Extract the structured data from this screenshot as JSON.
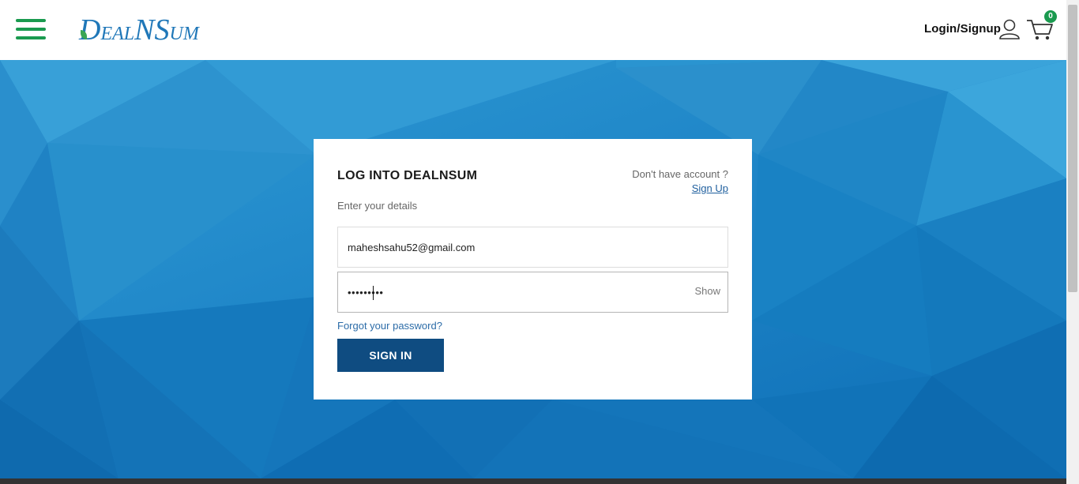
{
  "header": {
    "logo_text_first": "D",
    "logo_text_rest1": "EAL",
    "logo_text_n": "N",
    "logo_text_s": "S",
    "logo_text_rest2": "UM",
    "login_label": "Login/Signup",
    "cart_count": "0",
    "menu_icon": "hamburger-icon",
    "user_icon": "user-icon",
    "cart_icon": "cart-icon",
    "brand_green": "#1a9a4f",
    "brand_blue": "#1f77b8"
  },
  "login": {
    "title": "LOG INTO DEALNSUM",
    "no_account_text": "Don't have account ?",
    "signup_label": "Sign Up",
    "subtitle": "Enter your details",
    "email_value": "maheshsahu52@gmail.com",
    "password_value": "•••••••••",
    "show_label": "Show",
    "forgot_label": "Forgot your password?",
    "signin_label": "SIGN IN",
    "button_color": "#0f4c81"
  }
}
